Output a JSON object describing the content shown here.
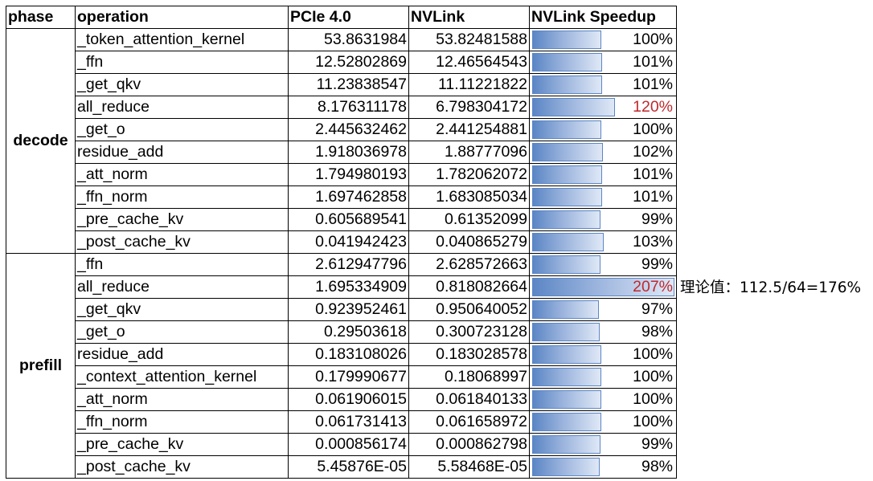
{
  "headers": [
    "phase",
    "operation",
    "PCIe 4.0",
    "NVLink",
    "NVLink Speedup"
  ],
  "groups": [
    {
      "phase": "decode",
      "rows": [
        {
          "op": "_token_attention_kernel",
          "pcie": "53.8631984",
          "nvlink": "53.82481588",
          "speedup": "100%",
          "pct": 100
        },
        {
          "op": "_ffn",
          "pcie": "12.52802869",
          "nvlink": "12.46564543",
          "speedup": "101%",
          "pct": 101
        },
        {
          "op": "_get_qkv",
          "pcie": "11.23838547",
          "nvlink": "11.11221822",
          "speedup": "101%",
          "pct": 101
        },
        {
          "op": "all_reduce",
          "pcie": "8.176311178",
          "nvlink": "6.798304172",
          "speedup": "120%",
          "pct": 120,
          "highlight": true
        },
        {
          "op": "_get_o",
          "pcie": "2.445632462",
          "nvlink": "2.441254881",
          "speedup": "100%",
          "pct": 100
        },
        {
          "op": "residue_add",
          "pcie": "1.918036978",
          "nvlink": "1.88777096",
          "speedup": "102%",
          "pct": 102
        },
        {
          "op": "_att_norm",
          "pcie": "1.794980193",
          "nvlink": "1.782062072",
          "speedup": "101%",
          "pct": 101
        },
        {
          "op": "_ffn_norm",
          "pcie": "1.697462858",
          "nvlink": "1.683085034",
          "speedup": "101%",
          "pct": 101
        },
        {
          "op": "_pre_cache_kv",
          "pcie": "0.605689541",
          "nvlink": "0.61352099",
          "speedup": "99%",
          "pct": 99
        },
        {
          "op": "_post_cache_kv",
          "pcie": "0.041942423",
          "nvlink": "0.040865279",
          "speedup": "103%",
          "pct": 103
        }
      ]
    },
    {
      "phase": "prefill",
      "rows": [
        {
          "op": "_ffn",
          "pcie": "2.612947796",
          "nvlink": "2.628572663",
          "speedup": "99%",
          "pct": 99
        },
        {
          "op": "all_reduce",
          "pcie": "1.695334909",
          "nvlink": "0.818082664",
          "speedup": "207%",
          "pct": 207,
          "highlight": true
        },
        {
          "op": "_get_qkv",
          "pcie": "0.923952461",
          "nvlink": "0.950640052",
          "speedup": "97%",
          "pct": 97
        },
        {
          "op": "_get_o",
          "pcie": "0.29503618",
          "nvlink": "0.300723128",
          "speedup": "98%",
          "pct": 98
        },
        {
          "op": "residue_add",
          "pcie": "0.183108026",
          "nvlink": "0.183028578",
          "speedup": "100%",
          "pct": 100
        },
        {
          "op": "_context_attention_kernel",
          "pcie": "0.179990677",
          "nvlink": "0.18068997",
          "speedup": "100%",
          "pct": 100
        },
        {
          "op": "_att_norm",
          "pcie": "0.061906015",
          "nvlink": "0.061840133",
          "speedup": "100%",
          "pct": 100
        },
        {
          "op": "_ffn_norm",
          "pcie": "0.061731413",
          "nvlink": "0.061658972",
          "speedup": "100%",
          "pct": 100
        },
        {
          "op": "_pre_cache_kv",
          "pcie": "0.000856174",
          "nvlink": "0.000862798",
          "speedup": "99%",
          "pct": 99
        },
        {
          "op": "_post_cache_kv",
          "pcie": "5.45876E-05",
          "nvlink": "5.58468E-05",
          "speedup": "98%",
          "pct": 98
        }
      ]
    }
  ],
  "note": "理论值：112.5/64=176%",
  "colors": {
    "bar": "#5b86c5",
    "highlight_text": "#c0282d"
  }
}
